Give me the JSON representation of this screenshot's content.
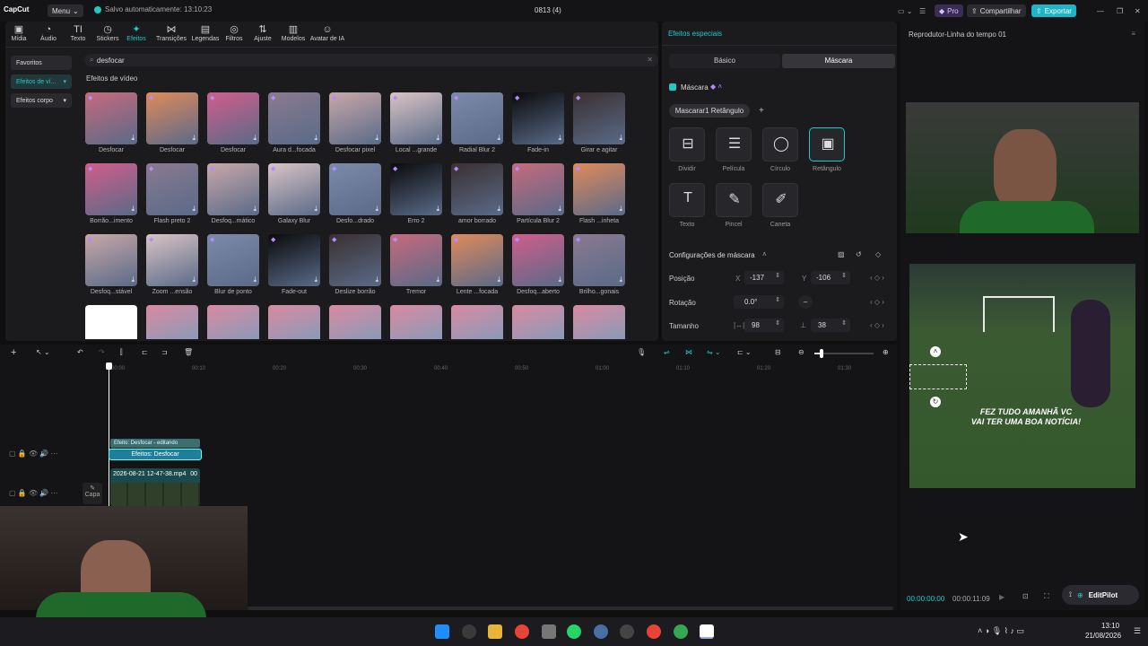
{
  "app": {
    "logo": "CapCut",
    "menu": "Menu",
    "saved": "Salvo automaticamente: 13:10:23",
    "project": "0813 (4)",
    "pro": "Pro",
    "share": "Compartilhar",
    "export": "Exportar"
  },
  "tabs": [
    "Mídia",
    "Áudio",
    "Texto",
    "Stickers",
    "Efeitos",
    "Transições",
    "Legendas",
    "Filtros",
    "Ajuste",
    "Modelos",
    "Avatar de IA"
  ],
  "side": [
    "Favoritos",
    "Efeitos de ví...",
    "Efeitos corpo"
  ],
  "search": {
    "value": "desfocar"
  },
  "section_title": "Efeitos de vídeo",
  "effects_row1": [
    "Desfocar",
    "Desfocar",
    "Desfocar",
    "Aura d...focada",
    "Desfocar pixel",
    "Local ...grande",
    "Radial Blur 2",
    "Fade-in",
    "Girar e agitar"
  ],
  "effects_row2": [
    "Borrão...imento",
    "Flash preto 2",
    "Desfoq...mático",
    "Galaxy Blur",
    "Desfo...drado",
    "Erro 2",
    "amor borrado",
    "Partícula Blur 2",
    "Flash ...inheta"
  ],
  "effects_row3": [
    "Desfoq...stável",
    "Zoom ...ensão",
    "Blur de ponto",
    "Fade-out",
    "Deslize borrão",
    "Tremor",
    "Lente ...focada",
    "Desfoq...aberto",
    "Brilho...gonais"
  ],
  "props": {
    "title": "Efeitos especiais",
    "tab_basic": "Básico",
    "tab_mask": "Máscara",
    "mask_label": "Máscara",
    "mask_chip": "Mascarar1 Retângulo",
    "shapes": [
      "Dividir",
      "Película",
      "Círculo",
      "Retângulo",
      "Texto",
      "Pincel",
      "Caneta"
    ],
    "config": "Configurações de máscara",
    "position_label": "Posição",
    "x_label": "X",
    "x_value": "-137",
    "y_label": "Y",
    "y_value": "-106",
    "rotation_label": "Rotação",
    "rotation_value": "0.0°",
    "size_label": "Tamanho",
    "w_value": "98",
    "h_value": "38"
  },
  "player": {
    "title": "Reprodutor-Linha do tempo 01",
    "time_current": "00:00:00:00",
    "time_total": "00:00:11:09",
    "caption_l1": "FEZ TUDO AMANHÃ VC",
    "caption_l2": "VAI TER UMA BOA NOTÍCIA!",
    "editpilot": "EditPilot"
  },
  "timeline": {
    "ticks": [
      "00:00",
      "00:10",
      "00:20",
      "00:30",
      "00:40",
      "00:50",
      "01:00",
      "01:10",
      "01:20",
      "01:30"
    ],
    "effect_clip_top": "Efeito: Desfocar - editando",
    "effect_clip": "Efeitos:  Desfocar",
    "video_clip": "2026-08-21 12-47-38.mp4",
    "video_clip_dur": "00",
    "cover": "Capa"
  },
  "taskbar": {
    "time": "13:10",
    "date": "21/08/2026"
  },
  "colors": {
    "accent": "#22c9c9",
    "export": "#1fb5c9",
    "bg": "#1b1b1e"
  }
}
